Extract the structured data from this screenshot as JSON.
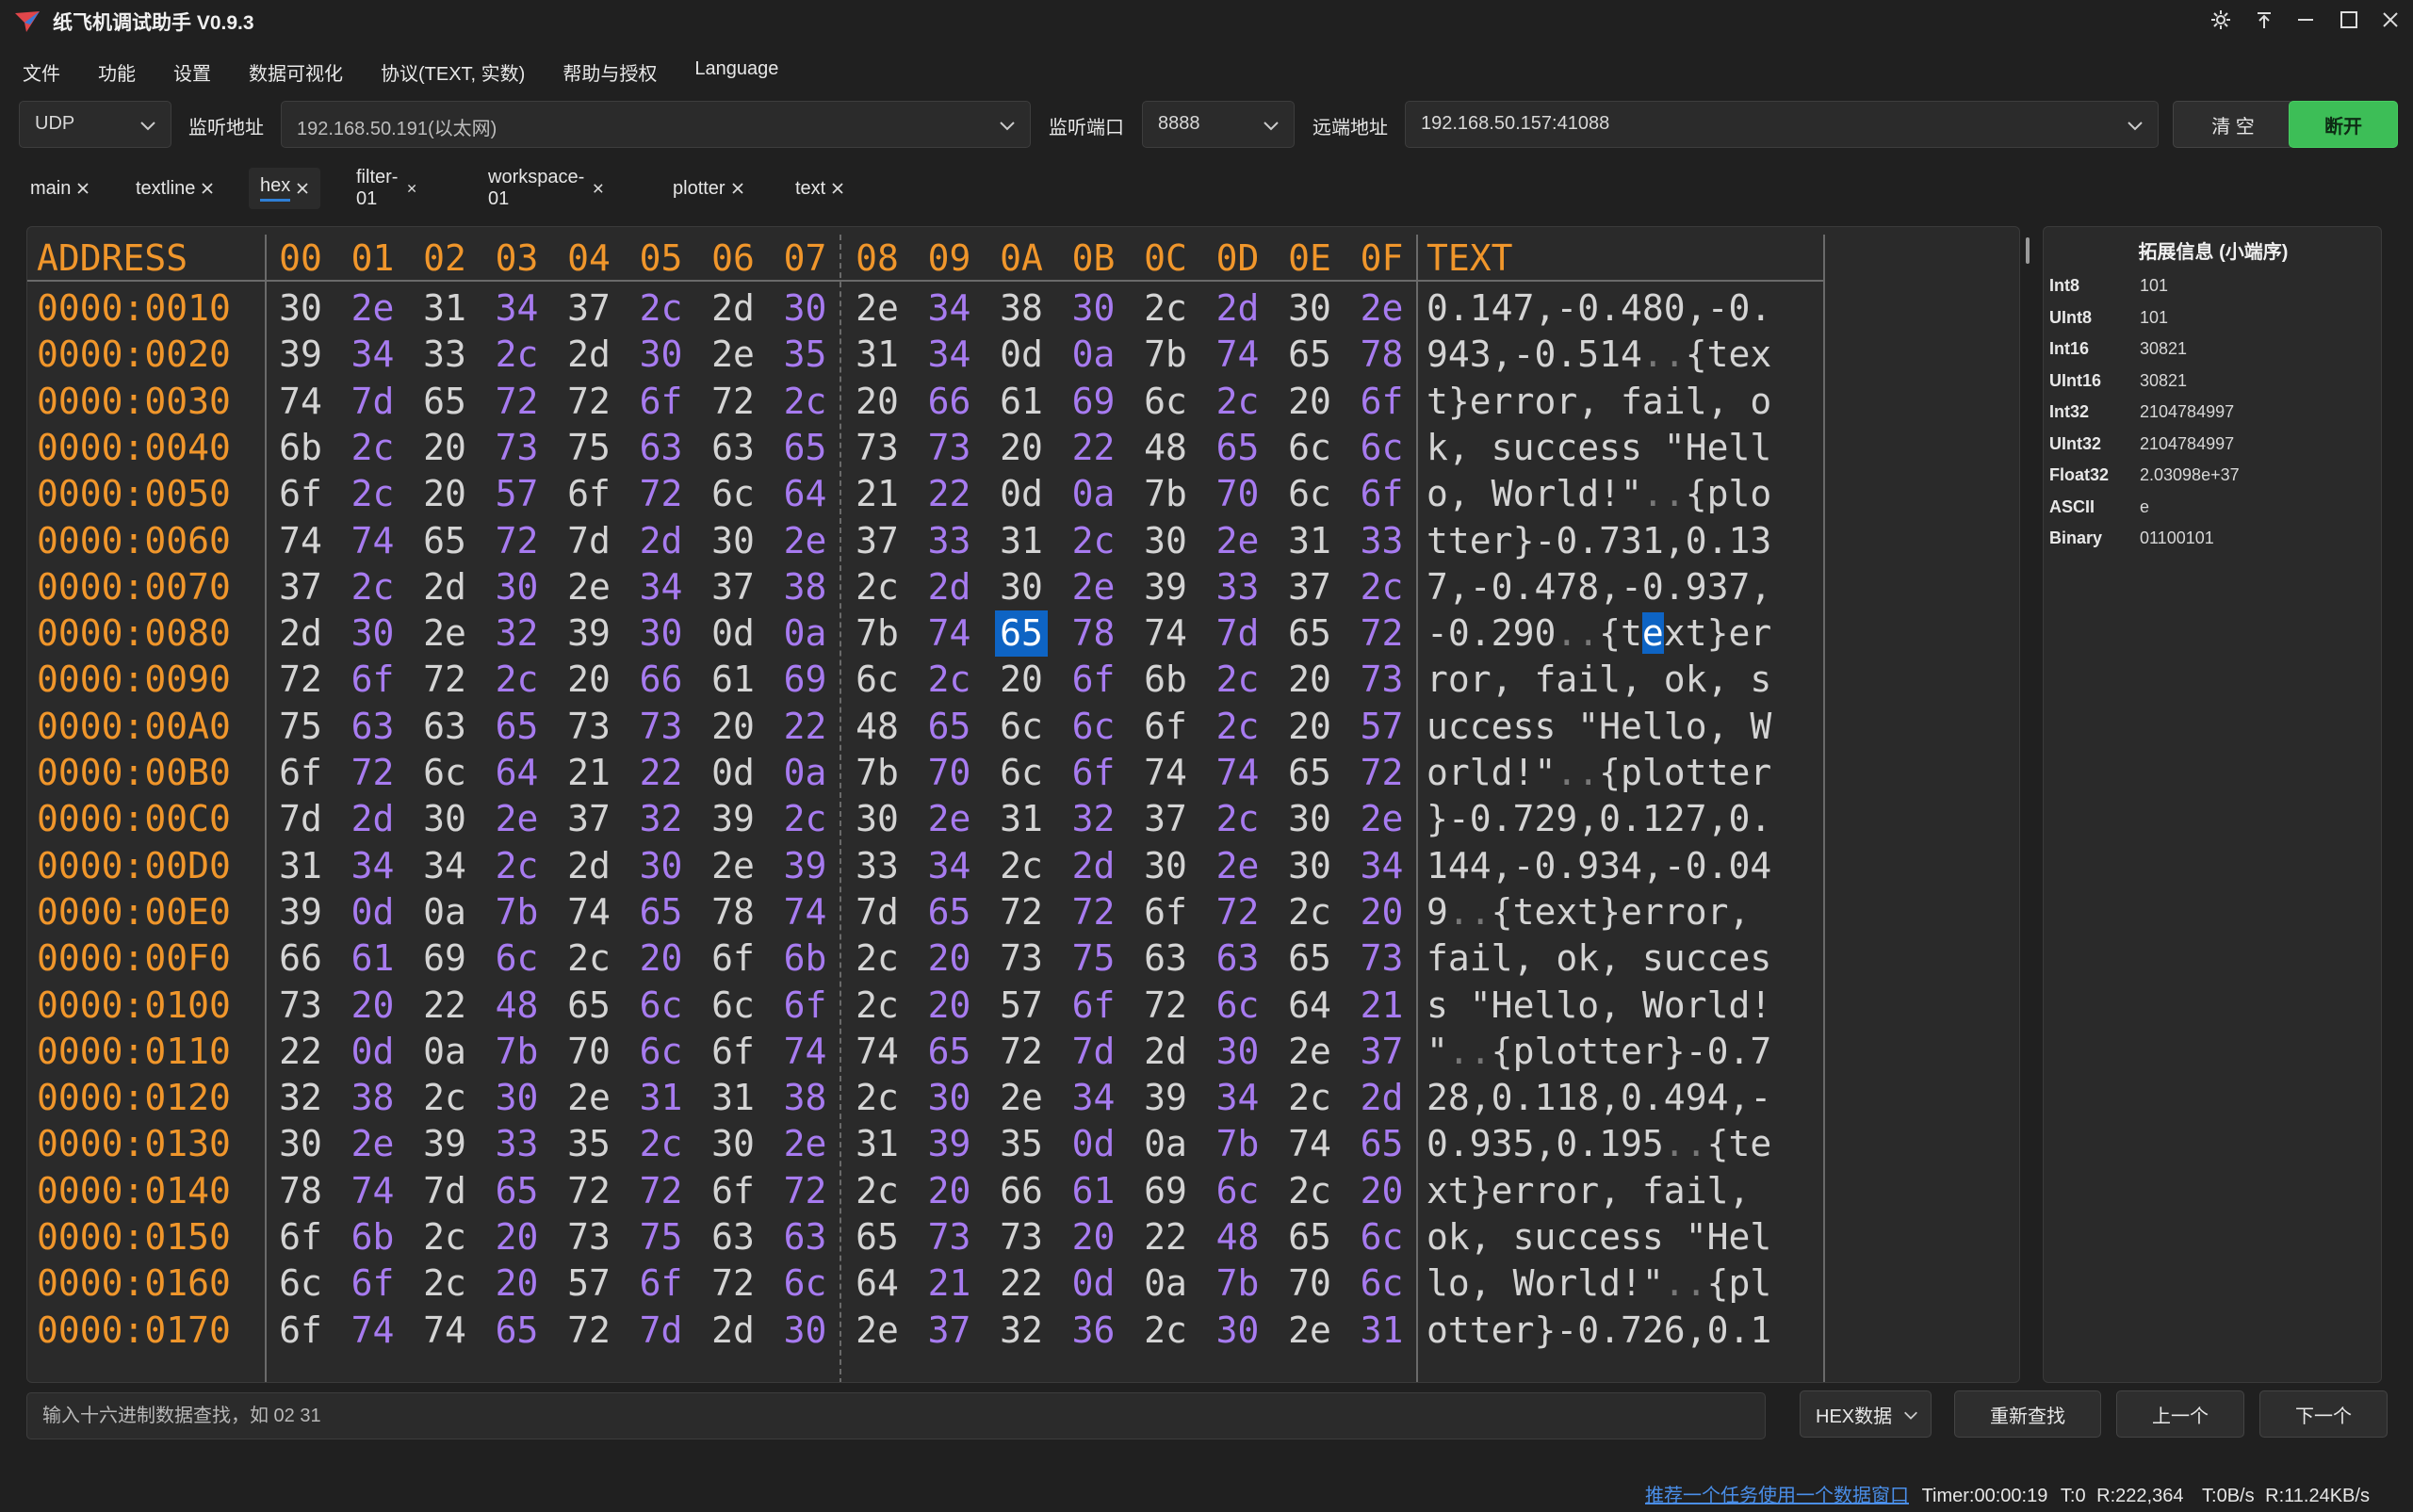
{
  "window": {
    "title": "纸飞机调试助手 V0.9.3",
    "controls": [
      "settings-icon",
      "pin-icon",
      "minimize-icon",
      "maximize-icon",
      "close-icon"
    ]
  },
  "menu": [
    "文件",
    "功能",
    "设置",
    "数据可视化",
    "协议(TEXT, 实数)",
    "帮助与授权",
    "Language"
  ],
  "toolbar": {
    "protocol": "UDP",
    "listen_addr_label": "监听地址",
    "listen_addr": "192.168.50.191(以太网)",
    "listen_port_label": "监听端口",
    "listen_port": "8888",
    "remote_addr_label": "远端地址",
    "remote_addr": "192.168.50.157:41088",
    "clear_label": "清 空",
    "disconnect_label": "断开",
    "disconnect_color": "#3dbe57"
  },
  "tabs": [
    {
      "label": "main"
    },
    {
      "label": "textline"
    },
    {
      "label": "hex",
      "active": true
    },
    {
      "label": "filter-01"
    },
    {
      "label": "workspace-01"
    },
    {
      "label": "plotter"
    },
    {
      "label": "text"
    }
  ],
  "hex_view": {
    "address_header": "ADDRESS",
    "column_headers": [
      "00",
      "01",
      "02",
      "03",
      "04",
      "05",
      "06",
      "07",
      "08",
      "09",
      "0A",
      "0B",
      "0C",
      "0D",
      "0E",
      "0F"
    ],
    "text_header": "TEXT",
    "selected": {
      "row": 7,
      "col": 10
    },
    "rows": [
      {
        "addr": "0000:0010",
        "bytes": [
          "30",
          "2e",
          "31",
          "34",
          "37",
          "2c",
          "2d",
          "30",
          "2e",
          "34",
          "38",
          "30",
          "2c",
          "2d",
          "30",
          "2e"
        ],
        "text": "0.147,-0.480,-0."
      },
      {
        "addr": "0000:0020",
        "bytes": [
          "39",
          "34",
          "33",
          "2c",
          "2d",
          "30",
          "2e",
          "35",
          "31",
          "34",
          "0d",
          "0a",
          "7b",
          "74",
          "65",
          "78"
        ],
        "text": "943,-0.514..{tex"
      },
      {
        "addr": "0000:0030",
        "bytes": [
          "74",
          "7d",
          "65",
          "72",
          "72",
          "6f",
          "72",
          "2c",
          "20",
          "66",
          "61",
          "69",
          "6c",
          "2c",
          "20",
          "6f"
        ],
        "text": "t}error, fail, o"
      },
      {
        "addr": "0000:0040",
        "bytes": [
          "6b",
          "2c",
          "20",
          "73",
          "75",
          "63",
          "63",
          "65",
          "73",
          "73",
          "20",
          "22",
          "48",
          "65",
          "6c",
          "6c"
        ],
        "text": "k, success \"Hell"
      },
      {
        "addr": "0000:0050",
        "bytes": [
          "6f",
          "2c",
          "20",
          "57",
          "6f",
          "72",
          "6c",
          "64",
          "21",
          "22",
          "0d",
          "0a",
          "7b",
          "70",
          "6c",
          "6f"
        ],
        "text": "o, World!\"..{plo"
      },
      {
        "addr": "0000:0060",
        "bytes": [
          "74",
          "74",
          "65",
          "72",
          "7d",
          "2d",
          "30",
          "2e",
          "37",
          "33",
          "31",
          "2c",
          "30",
          "2e",
          "31",
          "33"
        ],
        "text": "tter}-0.731,0.13"
      },
      {
        "addr": "0000:0070",
        "bytes": [
          "37",
          "2c",
          "2d",
          "30",
          "2e",
          "34",
          "37",
          "38",
          "2c",
          "2d",
          "30",
          "2e",
          "39",
          "33",
          "37",
          "2c"
        ],
        "text": "7,-0.478,-0.937,"
      },
      {
        "addr": "0000:0080",
        "bytes": [
          "2d",
          "30",
          "2e",
          "32",
          "39",
          "30",
          "0d",
          "0a",
          "7b",
          "74",
          "65",
          "78",
          "74",
          "7d",
          "65",
          "72"
        ],
        "text": "-0.290..{text}er"
      },
      {
        "addr": "0000:0090",
        "bytes": [
          "72",
          "6f",
          "72",
          "2c",
          "20",
          "66",
          "61",
          "69",
          "6c",
          "2c",
          "20",
          "6f",
          "6b",
          "2c",
          "20",
          "73"
        ],
        "text": "ror, fail, ok, s"
      },
      {
        "addr": "0000:00A0",
        "bytes": [
          "75",
          "63",
          "63",
          "65",
          "73",
          "73",
          "20",
          "22",
          "48",
          "65",
          "6c",
          "6c",
          "6f",
          "2c",
          "20",
          "57"
        ],
        "text": "uccess \"Hello, W"
      },
      {
        "addr": "0000:00B0",
        "bytes": [
          "6f",
          "72",
          "6c",
          "64",
          "21",
          "22",
          "0d",
          "0a",
          "7b",
          "70",
          "6c",
          "6f",
          "74",
          "74",
          "65",
          "72"
        ],
        "text": "orld!\"..{plotter"
      },
      {
        "addr": "0000:00C0",
        "bytes": [
          "7d",
          "2d",
          "30",
          "2e",
          "37",
          "32",
          "39",
          "2c",
          "30",
          "2e",
          "31",
          "32",
          "37",
          "2c",
          "30",
          "2e"
        ],
        "text": "}-0.729,0.127,0."
      },
      {
        "addr": "0000:00D0",
        "bytes": [
          "31",
          "34",
          "34",
          "2c",
          "2d",
          "30",
          "2e",
          "39",
          "33",
          "34",
          "2c",
          "2d",
          "30",
          "2e",
          "30",
          "34"
        ],
        "text": "144,-0.934,-0.04"
      },
      {
        "addr": "0000:00E0",
        "bytes": [
          "39",
          "0d",
          "0a",
          "7b",
          "74",
          "65",
          "78",
          "74",
          "7d",
          "65",
          "72",
          "72",
          "6f",
          "72",
          "2c",
          "20"
        ],
        "text": "9..{text}error, "
      },
      {
        "addr": "0000:00F0",
        "bytes": [
          "66",
          "61",
          "69",
          "6c",
          "2c",
          "20",
          "6f",
          "6b",
          "2c",
          "20",
          "73",
          "75",
          "63",
          "63",
          "65",
          "73"
        ],
        "text": "fail, ok, succes"
      },
      {
        "addr": "0000:0100",
        "bytes": [
          "73",
          "20",
          "22",
          "48",
          "65",
          "6c",
          "6c",
          "6f",
          "2c",
          "20",
          "57",
          "6f",
          "72",
          "6c",
          "64",
          "21"
        ],
        "text": "s \"Hello, World!"
      },
      {
        "addr": "0000:0110",
        "bytes": [
          "22",
          "0d",
          "0a",
          "7b",
          "70",
          "6c",
          "6f",
          "74",
          "74",
          "65",
          "72",
          "7d",
          "2d",
          "30",
          "2e",
          "37"
        ],
        "text": "\"..{plotter}-0.7"
      },
      {
        "addr": "0000:0120",
        "bytes": [
          "32",
          "38",
          "2c",
          "30",
          "2e",
          "31",
          "31",
          "38",
          "2c",
          "30",
          "2e",
          "34",
          "39",
          "34",
          "2c",
          "2d"
        ],
        "text": "28,0.118,0.494,-"
      },
      {
        "addr": "0000:0130",
        "bytes": [
          "30",
          "2e",
          "39",
          "33",
          "35",
          "2c",
          "30",
          "2e",
          "31",
          "39",
          "35",
          "0d",
          "0a",
          "7b",
          "74",
          "65"
        ],
        "text": "0.935,0.195..{te"
      },
      {
        "addr": "0000:0140",
        "bytes": [
          "78",
          "74",
          "7d",
          "65",
          "72",
          "72",
          "6f",
          "72",
          "2c",
          "20",
          "66",
          "61",
          "69",
          "6c",
          "2c",
          "20"
        ],
        "text": "xt}error, fail, "
      },
      {
        "addr": "0000:0150",
        "bytes": [
          "6f",
          "6b",
          "2c",
          "20",
          "73",
          "75",
          "63",
          "63",
          "65",
          "73",
          "73",
          "20",
          "22",
          "48",
          "65",
          "6c"
        ],
        "text": "ok, success \"Hel"
      },
      {
        "addr": "0000:0160",
        "bytes": [
          "6c",
          "6f",
          "2c",
          "20",
          "57",
          "6f",
          "72",
          "6c",
          "64",
          "21",
          "22",
          "0d",
          "0a",
          "7b",
          "70",
          "6c"
        ],
        "text": "lo, World!\"..{pl"
      },
      {
        "addr": "0000:0170",
        "bytes": [
          "6f",
          "74",
          "74",
          "65",
          "72",
          "7d",
          "2d",
          "30",
          "2e",
          "37",
          "32",
          "36",
          "2c",
          "30",
          "2e",
          "31"
        ],
        "text": "otter}-0.726,0.1"
      }
    ]
  },
  "info_panel": {
    "title": "拓展信息 (小端序)",
    "rows": [
      {
        "key": "Int8",
        "value": "101"
      },
      {
        "key": "UInt8",
        "value": "101"
      },
      {
        "key": "Int16",
        "value": "30821"
      },
      {
        "key": "UInt16",
        "value": "30821"
      },
      {
        "key": "Int32",
        "value": "2104784997"
      },
      {
        "key": "UInt32",
        "value": "2104784997"
      },
      {
        "key": "Float32",
        "value": "2.03098e+37"
      },
      {
        "key": "ASCII",
        "value": "e"
      },
      {
        "key": "Binary",
        "value": "01100101"
      }
    ]
  },
  "search": {
    "placeholder": "输入十六进制数据查找，如 02 31",
    "mode": "HEX数据",
    "research_label": "重新查找",
    "prev_label": "上一个",
    "next_label": "下一个"
  },
  "status": {
    "link": "推荐一个任务使用一个数据窗口",
    "timer": "Timer:00:00:19",
    "tx": "T:0",
    "rx": "R:222,364",
    "tx_rate": "T:0B/s",
    "rx_rate": "R:11.24KB/s"
  }
}
